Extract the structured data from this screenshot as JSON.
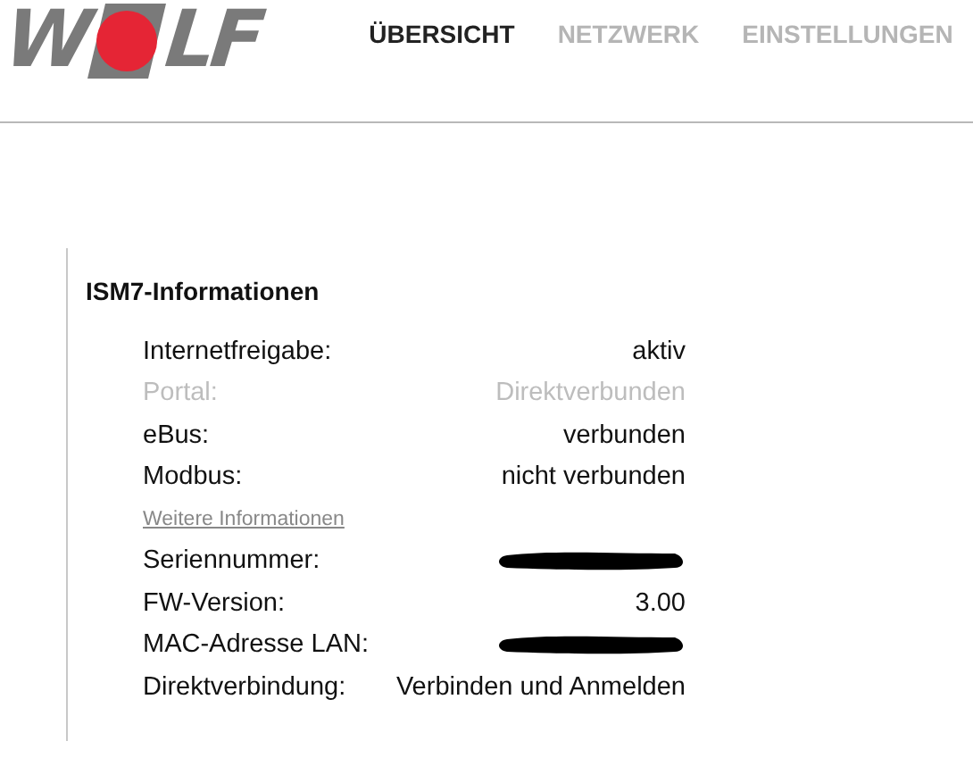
{
  "logo": {
    "before": "W",
    "after": "LF"
  },
  "nav": [
    {
      "label": "ÜBERSICHT",
      "selected": true
    },
    {
      "label": "NETZWERK",
      "selected": false
    },
    {
      "label": "EINSTELLUNGEN",
      "selected": false
    }
  ],
  "panel": {
    "title": "ISM7-Informationen",
    "rows": [
      {
        "kind": "pair",
        "label": "Internetfreigabe:",
        "value": "aktiv",
        "disabled": false
      },
      {
        "kind": "pair",
        "label": "Portal:",
        "value": "Direktverbunden",
        "disabled": true
      },
      {
        "kind": "pair",
        "label": "eBus:",
        "value": "verbunden",
        "disabled": false
      },
      {
        "kind": "pair",
        "label": "Modbus:",
        "value": "nicht verbunden",
        "disabled": false
      },
      {
        "kind": "link",
        "label": "Weitere Informationen"
      },
      {
        "kind": "redacted",
        "label": "Seriennummer:",
        "disabled": false
      },
      {
        "kind": "pair",
        "label": "FW-Version:",
        "value": "3.00",
        "disabled": false
      },
      {
        "kind": "redacted",
        "label": "MAC-Adresse LAN:",
        "disabled": false
      },
      {
        "kind": "pair",
        "label": "Direktverbindung:",
        "value": "Verbinden und Anmelden",
        "disabled": false
      }
    ]
  }
}
